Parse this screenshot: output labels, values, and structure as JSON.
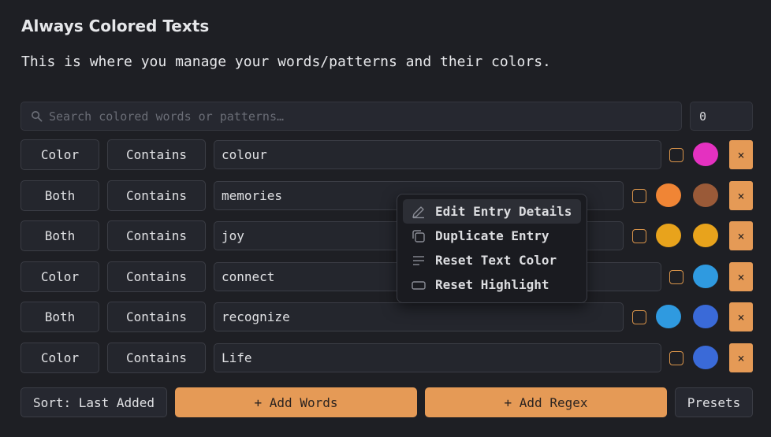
{
  "header": {
    "title": "Always Colored Texts",
    "description": "This is where you manage your words/patterns and their colors."
  },
  "search": {
    "placeholder": "Search colored words or patterns…",
    "count": "0"
  },
  "rows": [
    {
      "mode": "Color",
      "match": "Contains",
      "word": "colour",
      "text_color": null,
      "highlight_color": "#e431c0"
    },
    {
      "mode": "Both",
      "match": "Contains",
      "word": "memories",
      "text_color": "#f08535",
      "highlight_color": "#9a5a38"
    },
    {
      "mode": "Both",
      "match": "Contains",
      "word": "joy",
      "text_color": "#e8a31c",
      "highlight_color": "#e8a31c"
    },
    {
      "mode": "Color",
      "match": "Contains",
      "word": "connect",
      "text_color": null,
      "highlight_color": "#2f9ae0"
    },
    {
      "mode": "Both",
      "match": "Contains",
      "word": "recognize",
      "text_color": "#2f9ae0",
      "highlight_color": "#3a6ad8"
    },
    {
      "mode": "Color",
      "match": "Contains",
      "word": "Life",
      "text_color": null,
      "highlight_color": "#3a6ad8"
    }
  ],
  "delete_label": "×",
  "footer": {
    "sort_label": "Sort: Last Added",
    "add_words_label": "+ Add Words",
    "add_regex_label": "+ Add Regex",
    "presets_label": "Presets"
  },
  "context_menu": {
    "items": [
      {
        "label": "Edit Entry Details",
        "icon": "pencil-icon"
      },
      {
        "label": "Duplicate Entry",
        "icon": "duplicate-icon"
      },
      {
        "label": "Reset Text Color",
        "icon": "text-lines-icon"
      },
      {
        "label": "Reset Highlight",
        "icon": "highlight-rect-icon"
      }
    ]
  },
  "colors": {
    "accent": "#e59a56",
    "background": "#1e1f24"
  }
}
